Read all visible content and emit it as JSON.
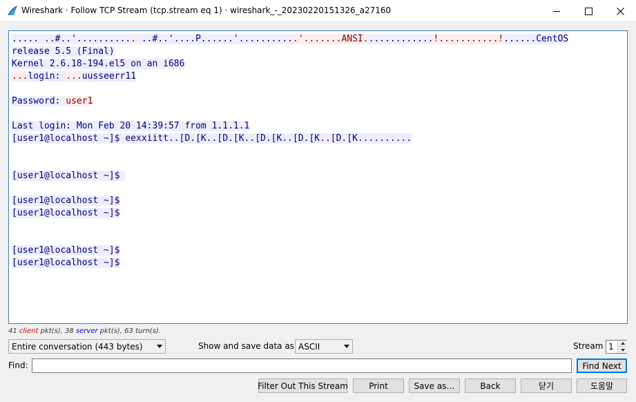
{
  "window": {
    "title": "Wireshark · Follow TCP Stream (tcp.stream eq 1) · wireshark_-_20230220151326_a27160",
    "icon": "wireshark-fin-icon",
    "controls": [
      "minimize-icon",
      "maximize-icon",
      "close-icon"
    ]
  },
  "stream": {
    "lines": [
      [
        {
          "dir": "server",
          "text": "..... ..#..'.........."
        },
        {
          "dir": "client",
          "text": "."
        },
        {
          "dir": "server",
          "text": " ..#..'....P......'.........."
        },
        {
          "dir": "client",
          "text": ".'.......ANSI."
        },
        {
          "dir": "server",
          "text": "............"
        },
        {
          "dir": "client",
          "text": "!...........!"
        },
        {
          "dir": "server",
          "text": "......CentOS"
        }
      ],
      [
        {
          "dir": "server",
          "text": "release 5.5 (Final)"
        }
      ],
      [
        {
          "dir": "server",
          "text": "Kernel 2.6.18-194.el5 on an i686"
        }
      ],
      [
        {
          "dir": "client",
          "text": "..."
        },
        {
          "dir": "server",
          "text": "login: "
        },
        {
          "dir": "client",
          "text": "..."
        },
        {
          "dir": "server",
          "text": "uusseerr11"
        }
      ],
      [],
      [
        {
          "dir": "server",
          "text": "Password: "
        },
        {
          "dir": "client",
          "text": "user1"
        }
      ],
      [],
      [
        {
          "dir": "server",
          "text": "Last login: Mon Feb 20 14:39:57 from 1.1.1.1"
        }
      ],
      [
        {
          "dir": "server",
          "text": "[user1@localhost ~]$ eexxiitt..[D.[K..[D.[K..[D.[K..[D.[K..[D.[K.........."
        }
      ],
      [],
      [],
      [
        {
          "dir": "server",
          "text": "[user1@localhost ~]$ "
        }
      ],
      [],
      [
        {
          "dir": "server",
          "text": "[user1@localhost ~]$"
        }
      ],
      [
        {
          "dir": "server",
          "text": "[user1@localhost ~]$"
        }
      ],
      [],
      [],
      [
        {
          "dir": "server",
          "text": "[user1@localhost ~]$"
        }
      ],
      [
        {
          "dir": "server",
          "text": "[user1@localhost ~]$"
        }
      ]
    ],
    "colors": {
      "client_bg": "#fbeded",
      "client_fg": "#7f0000",
      "server_bg": "#ededfb",
      "server_fg": "#00007f"
    }
  },
  "stats": {
    "client_count": "41",
    "client_word": "client",
    "client_suffix": " pkt(s), ",
    "server_count": "38",
    "server_word": "server",
    "server_suffix": " pkt(s), 63 turn(s)."
  },
  "controls": {
    "conversation_value": "Entire conversation (443 bytes)",
    "show_label": "Show and save data as",
    "format_value": "ASCII",
    "stream_label": "Stream",
    "stream_number": "1",
    "find_label": "Find:",
    "find_value": "",
    "find_next_label": "Find Next"
  },
  "buttons": {
    "filter": "Filter Out This Stream",
    "print": "Print",
    "save_as": "Save as…",
    "back": "Back",
    "close": "닫기",
    "help": "도움말"
  }
}
